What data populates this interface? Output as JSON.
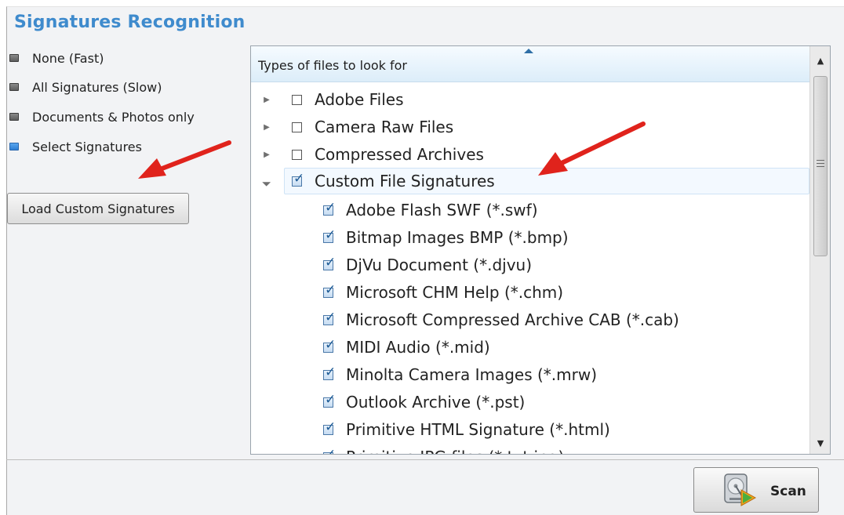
{
  "title": "Signatures Recognition",
  "radio_options": [
    {
      "label": "None (Fast)",
      "selected": false
    },
    {
      "label": "All Signatures (Slow)",
      "selected": false
    },
    {
      "label": "Documents & Photos only",
      "selected": false
    },
    {
      "label": "Select Signatures",
      "selected": true
    }
  ],
  "load_button_label": "Load Custom Signatures",
  "tree": {
    "header": "Types of files to look for",
    "groups": [
      {
        "label": "Adobe Files",
        "checked": false,
        "expanded": false
      },
      {
        "label": "Camera Raw Files",
        "checked": false,
        "expanded": false
      },
      {
        "label": "Compressed Archives",
        "checked": false,
        "expanded": false
      },
      {
        "label": "Custom File Signatures",
        "checked": true,
        "expanded": true
      }
    ],
    "children": [
      "Adobe Flash SWF (*.swf)",
      "Bitmap Images BMP (*.bmp)",
      "DjVu Document (*.djvu)",
      "Microsoft CHM Help (*.chm)",
      "Microsoft Compressed Archive CAB (*.cab)",
      "MIDI Audio (*.mid)",
      "Minolta Camera Images (*.mrw)",
      "Outlook Archive (*.pst)",
      "Primitive HTML Signature (*.html)",
      "Primitive JPG files (*.txt.jpg)"
    ]
  },
  "scan_button_label": "Scan",
  "colors": {
    "accent": "#3f8bcd",
    "arrow": "#e0231c"
  }
}
